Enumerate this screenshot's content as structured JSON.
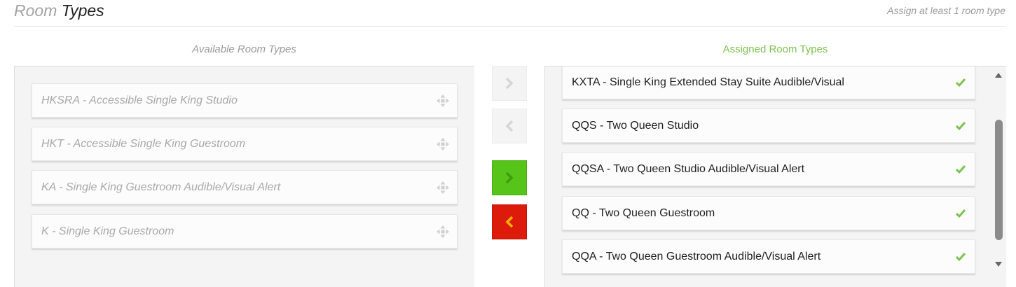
{
  "header": {
    "title_part1": "Room",
    "title_part2": "Types",
    "hint": "Assign at least 1 room type"
  },
  "available": {
    "title": "Available Room Types",
    "items": [
      {
        "label": "HKSRA - Accessible Single King Studio"
      },
      {
        "label": "HKT - Accessible Single King Guestroom"
      },
      {
        "label": "KA - Single King Guestroom Audible/Visual Alert"
      },
      {
        "label": "K - Single King Guestroom"
      }
    ],
    "item_icon": "move-icon"
  },
  "assigned": {
    "title": "Assigned Room Types",
    "items": [
      {
        "label": "KXTA - Single King Extended Stay Suite Audible/Visual"
      },
      {
        "label": "QQS - Two Queen Studio"
      },
      {
        "label": "QQSA - Two Queen Studio Audible/Visual Alert"
      },
      {
        "label": "QQ - Two Queen Guestroom"
      },
      {
        "label": "QQA - Two Queen Guestroom Audible/Visual Alert"
      }
    ],
    "item_icon": "checkmark-icon"
  },
  "controls": {
    "move_right_one": {
      "icon": "chevron-right-icon",
      "state": "disabled"
    },
    "move_left_one": {
      "icon": "chevron-left-icon",
      "state": "disabled"
    },
    "move_all_right": {
      "icon": "chevron-right-icon",
      "state": "enabled",
      "color": "#57c41a"
    },
    "move_all_left": {
      "icon": "chevron-left-icon",
      "state": "enabled",
      "color": "#dc1b0b"
    }
  },
  "colors": {
    "assigned_title": "#7cc24e",
    "checkmark": "#7cc24e",
    "green_button": "#57c41a",
    "red_button": "#dc1b0b",
    "red_button_arrow": "#ffb000"
  }
}
